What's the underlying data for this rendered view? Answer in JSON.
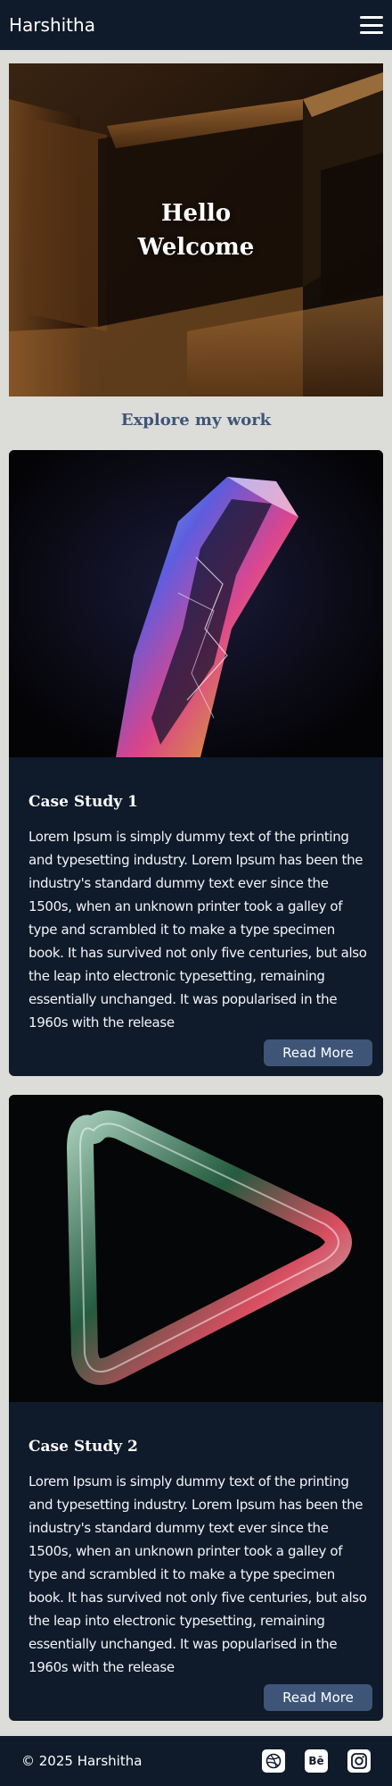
{
  "header": {
    "brand": "Harshitha",
    "menu_icon": "hamburger-menu-icon"
  },
  "hero": {
    "line1": "Hello",
    "line2": "Welcome"
  },
  "explore": {
    "heading": "Explore my work"
  },
  "cards": [
    {
      "title": "Case Study 1",
      "body": "Lorem Ipsum is simply dummy text of the printing and typesetting industry. Lorem Ipsum has been the industry's standard dummy text ever since the 1500s, when an unknown printer took a galley of type and scrambled it to make a type specimen book. It has survived not only five centuries, but also the leap into electronic typesetting, remaining essentially unchanged. It was popularised in the 1960s with the release",
      "button": "Read More"
    },
    {
      "title": "Case Study 2",
      "body": "Lorem Ipsum is simply dummy text of the printing and typesetting industry. Lorem Ipsum has been the industry's standard dummy text ever since the 1500s, when an unknown printer took a galley of type and scrambled it to make a type specimen book. It has survived not only five centuries, but also the leap into electronic typesetting, remaining essentially unchanged. It was popularised in the 1960s with the release",
      "button": "Read More"
    }
  ],
  "footer": {
    "copyright": "© 2025 Harshitha",
    "socials": [
      "dribbble-icon",
      "behance-icon",
      "instagram-icon"
    ],
    "behance_glyph": "Bē"
  },
  "colors": {
    "navy": "#0f1a2a",
    "page_bg": "#dcdcd8",
    "accent": "#3e5578"
  }
}
